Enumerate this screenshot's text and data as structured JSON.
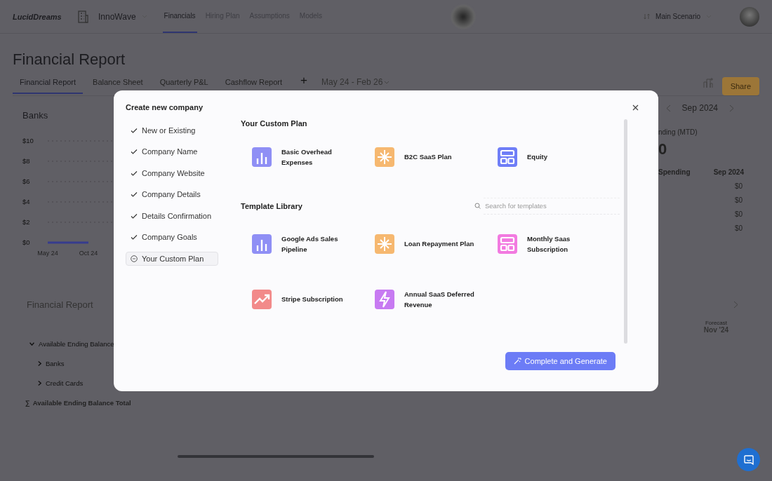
{
  "top_bar": {
    "logo": "LucidDreams",
    "company": "InnoWave",
    "nav": [
      {
        "label": "Financials",
        "selected": true
      },
      {
        "label": "Hiring Plan",
        "selected": false
      },
      {
        "label": "Assumptions",
        "selected": false
      },
      {
        "label": "Models",
        "selected": false
      }
    ],
    "scenario": "Main Scenario"
  },
  "page": {
    "title": "Financial Report",
    "tabs": [
      {
        "label": "Financial Report",
        "selected": true
      },
      {
        "label": "Balance Sheet",
        "selected": false
      },
      {
        "label": "Quarterly P&L",
        "selected": false
      },
      {
        "label": "Cashflow Report",
        "selected": false
      }
    ],
    "add_tab": "+",
    "date_range": "May 24 - Feb 26",
    "share": "Share"
  },
  "banks": {
    "chart_data": {
      "type": "line",
      "title": "Banks",
      "grid": true,
      "categories": [
        "May 24",
        "Oct 24"
      ],
      "series": [
        {
          "color": "#363c8e",
          "values": [
            0,
            0
          ]
        }
      ],
      "ylim": [
        0,
        10
      ],
      "yticks": [
        {
          "value": 0,
          "label": "$0"
        },
        {
          "value": 2,
          "label": "$2"
        },
        {
          "value": 4,
          "label": "$4"
        },
        {
          "value": 6,
          "label": "$6"
        },
        {
          "value": 8,
          "label": "$8"
        },
        {
          "value": 10,
          "label": "$10"
        }
      ]
    }
  },
  "spending": {
    "month": "Sep 2024",
    "metric_label": "nding (MTD)",
    "metric_value": "0",
    "columns": [
      "Spending",
      "Sep 2024"
    ],
    "values": [
      "$0",
      "$0",
      "$0",
      "$0"
    ]
  },
  "report": {
    "title": "Financial Report",
    "forecast_label": "Forecast",
    "month": "Nov '24",
    "rows": [
      {
        "label": "Available Ending Balance",
        "expanded": true,
        "children": [
          {
            "label": "Banks",
            "expanded": false
          },
          {
            "label": "Credit Cards",
            "expanded": false
          }
        ]
      }
    ],
    "total_symbol": "∑",
    "total": "Available Ending Balance Total"
  },
  "modal": {
    "title": "Create new company",
    "steps": [
      {
        "label": "New or Existing",
        "done": true,
        "selected": false
      },
      {
        "label": "Company Name",
        "done": true,
        "selected": false
      },
      {
        "label": "Company Website",
        "done": true,
        "selected": false
      },
      {
        "label": "Company Details",
        "done": true,
        "selected": false
      },
      {
        "label": "Details Confirmation",
        "done": true,
        "selected": false
      },
      {
        "label": "Company Goals",
        "done": true,
        "selected": false
      },
      {
        "label": "Your Custom Plan",
        "done": false,
        "selected": true
      }
    ],
    "custom_plan": {
      "title": "Your Custom Plan",
      "items": [
        {
          "label": "Basic Overhead Expenses",
          "kind": "bars",
          "color": "#8f8ff5"
        },
        {
          "label": "B2C SaaS Plan",
          "kind": "cross",
          "color": "#f6b870"
        },
        {
          "label": "Equity",
          "kind": "layout",
          "color": "#6f7ef7"
        }
      ]
    },
    "template_library": {
      "title": "Template Library",
      "search_placeholder": "Search for templates",
      "items": [
        {
          "label": "Google Ads Sales Pipeline",
          "kind": "bars",
          "color": "#8f8ff5"
        },
        {
          "label": "Loan Repayment Plan",
          "kind": "cross",
          "color": "#f6b870"
        },
        {
          "label": "Monthly Saas Subscription",
          "kind": "layout",
          "color": "#f27ae0"
        },
        {
          "label": "Stripe Subscription",
          "kind": "trend",
          "color": "#f28a8a"
        },
        {
          "label": "Annual SaaS Deferred Revenue",
          "kind": "bolt",
          "color": "#c77af2"
        }
      ]
    },
    "button": "Complete and Generate"
  }
}
